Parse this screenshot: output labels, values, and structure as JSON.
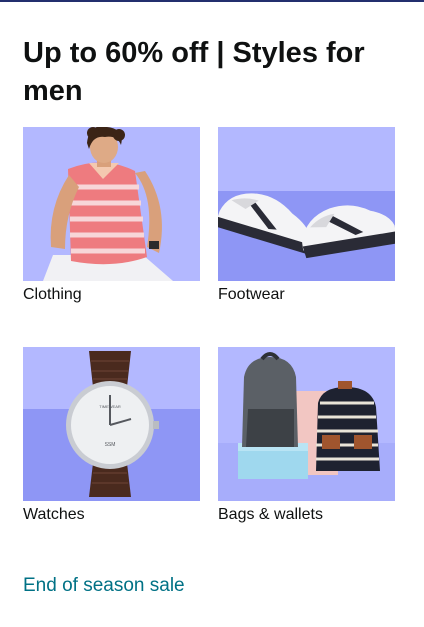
{
  "card": {
    "title": "Up to 60% off | Styles for men",
    "see_more_label": "End of season sale"
  },
  "tiles": [
    {
      "label": "Clothing",
      "icon": "men-clothing-image"
    },
    {
      "label": "Footwear",
      "icon": "sneakers-image"
    },
    {
      "label": "Watches",
      "icon": "wristwatch-image",
      "watch_brand": "TIMEWEAR",
      "watch_dial_text": "SSM"
    },
    {
      "label": "Bags & wallets",
      "icon": "backpack-image"
    }
  ],
  "colors": {
    "tile_bg_light": "#b3b8ff",
    "tile_bg_dark": "#8e96f5",
    "link": "#007185",
    "top_rule": "#232f6e"
  }
}
